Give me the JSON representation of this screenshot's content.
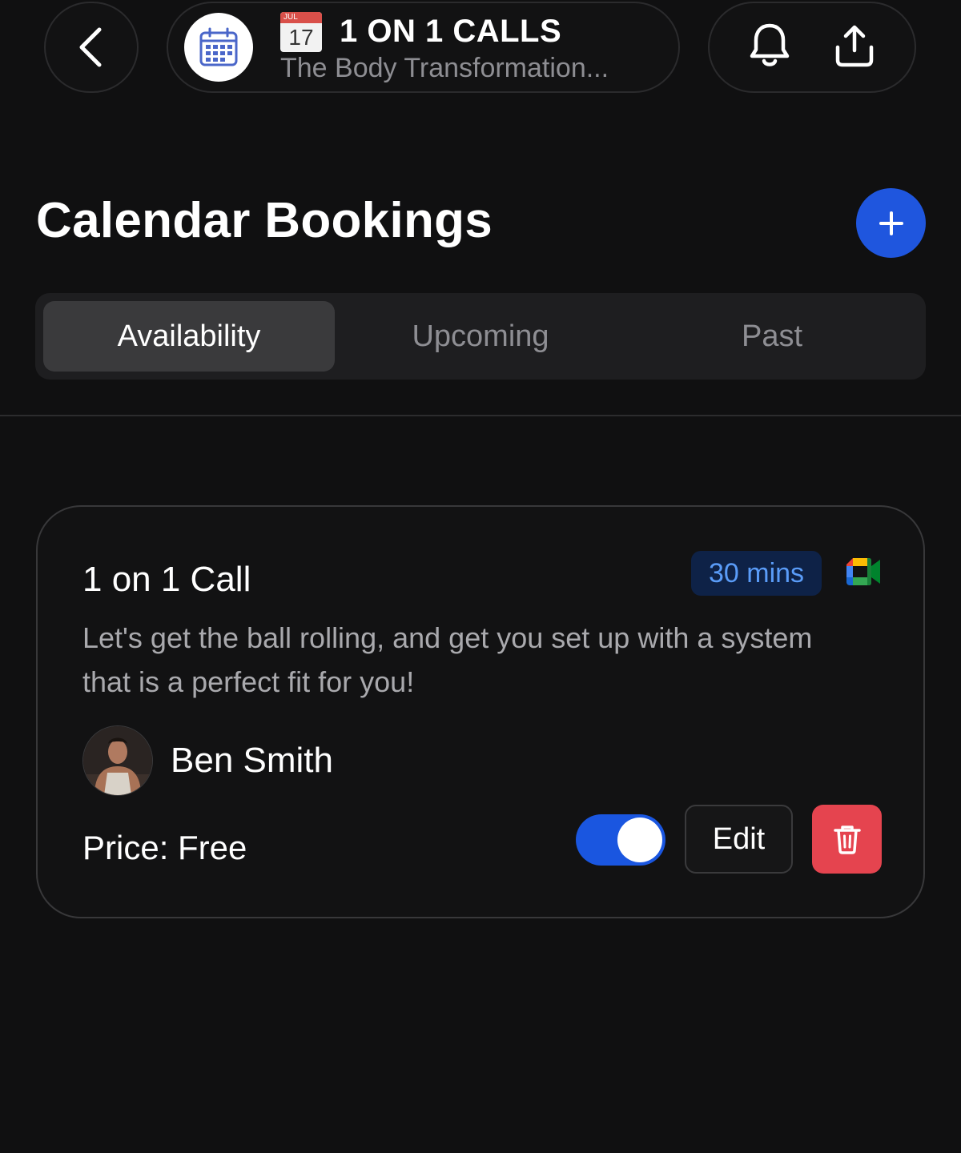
{
  "header": {
    "back_icon": "chevron-left-icon",
    "channel_logo_icon": "calendar-icon",
    "channel_emoji_month": "JUL",
    "channel_emoji_day": "17",
    "channel_title": "1 ON 1 CALLS",
    "channel_subtitle": "The Body Transformation...",
    "bell_icon": "bell-icon",
    "share_icon": "share-icon"
  },
  "page": {
    "title": "Calendar Bookings",
    "add_icon": "plus-icon"
  },
  "tabs": [
    {
      "label": "Availability",
      "active": true
    },
    {
      "label": "Upcoming",
      "active": false
    },
    {
      "label": "Past",
      "active": false
    }
  ],
  "booking": {
    "title": "1 on 1 Call",
    "duration": "30 mins",
    "meeting_icon": "google-meet-icon",
    "description": "Let's get the ball rolling, and get you set up with a system that is a perfect fit for you!",
    "host_name": "Ben Smith",
    "price": "Price: Free",
    "enabled": true,
    "edit_label": "Edit",
    "delete_icon": "trash-icon"
  },
  "colors": {
    "background": "#101011",
    "accent_blue": "#1f56de",
    "badge_bg": "#0e2247",
    "badge_text": "#5a9cf8",
    "delete_red": "#e5444f"
  }
}
